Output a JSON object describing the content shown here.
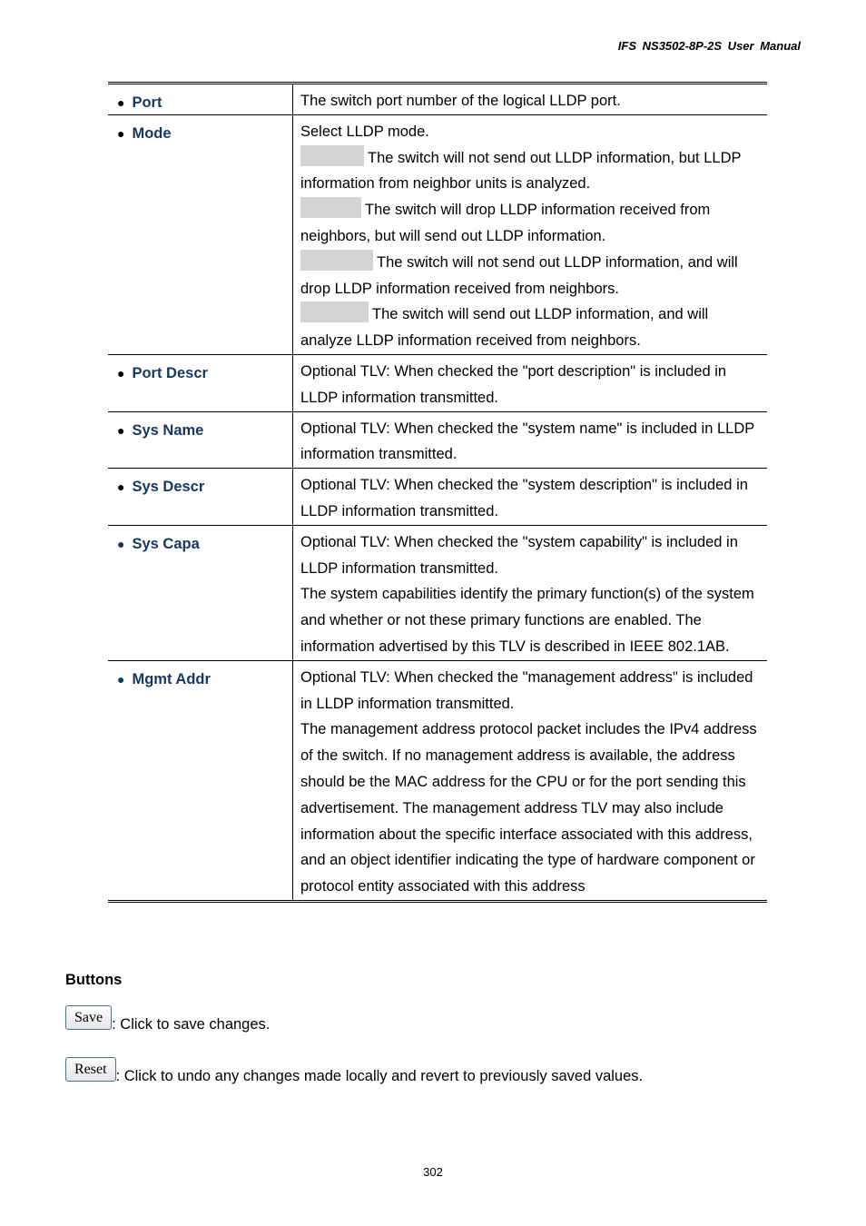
{
  "header": {
    "title": "IFS  NS3502-8P-2S  User  Manual"
  },
  "table": {
    "rows": [
      {
        "name": "Port",
        "lines": [
          "The switch port number of the logical LLDP port."
        ]
      },
      {
        "name": "Mode",
        "intro": "Select LLDP mode.",
        "modes": [
          "The switch will not send out LLDP information, but LLDP information from neighbor units is analyzed.",
          "The switch will drop LLDP information received from neighbors, but will send out LLDP information.",
          "The switch will not send out LLDP information, and will drop LLDP information received from neighbors.",
          "The switch will send out LLDP information, and will analyze LLDP information received from neighbors."
        ]
      },
      {
        "name": "Port Descr",
        "lines": [
          "Optional TLV: When checked the \"port description\" is included in LLDP information transmitted."
        ]
      },
      {
        "name": "Sys Name",
        "lines": [
          "Optional TLV: When checked the \"system name\" is included in LLDP information transmitted."
        ]
      },
      {
        "name": "Sys Descr",
        "lines": [
          "Optional TLV: When checked the \"system description\" is included in LLDP information transmitted."
        ]
      },
      {
        "name": "Sys Capa",
        "lines": [
          "Optional TLV: When checked the \"system capability\" is included in LLDP information transmitted.",
          "The system capabilities identify the primary function(s) of the system and whether or not these primary functions are enabled. The information advertised by this TLV is described in IEEE 802.1AB."
        ]
      },
      {
        "name": "Mgmt Addr",
        "lines": [
          "Optional TLV: When checked the \"management address\" is included in LLDP information transmitted.",
          "The management address protocol packet includes the IPv4 address of the switch. If no management address is available, the address should be the MAC address for the CPU or for the port sending this advertisement. The management address TLV may also include information about the specific interface associated with this address, and an object identifier indicating the type of hardware component or protocol entity associated with this address"
        ]
      }
    ]
  },
  "buttons_section": {
    "title": "Buttons",
    "save": {
      "label": "Save",
      "desc": ": Click to save changes."
    },
    "reset": {
      "label": "Reset",
      "desc": ": Click to undo any changes made locally and revert to previously saved values."
    }
  },
  "page_number": "302"
}
